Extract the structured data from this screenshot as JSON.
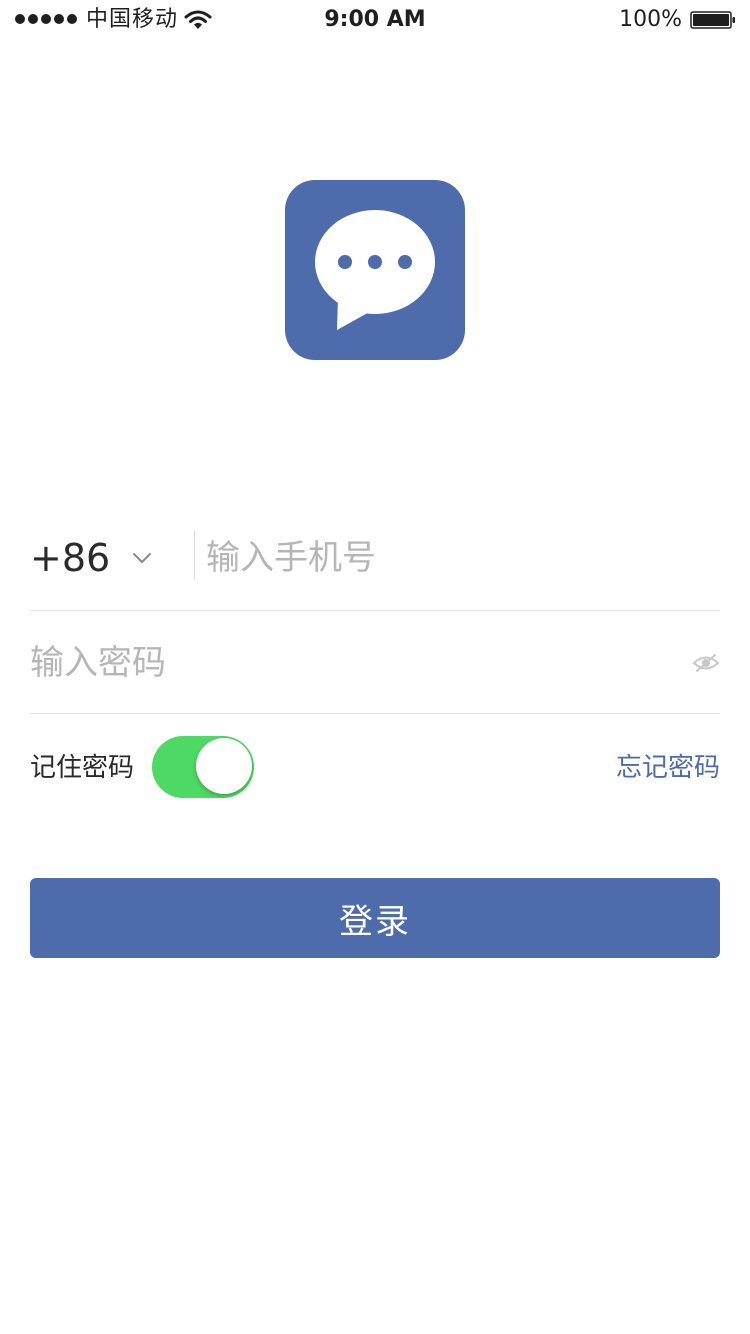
{
  "status_bar": {
    "carrier": "中国移动",
    "time": "9:00 AM",
    "battery": "100%",
    "icons": [
      "signal-dots",
      "wifi-icon",
      "battery-icon"
    ]
  },
  "logo": {
    "icon": "chat-bubble-icon",
    "background_color": "#4e6bab"
  },
  "phone": {
    "country_code": "+86",
    "placeholder": "输入手机号",
    "value": ""
  },
  "password": {
    "placeholder": "输入密码",
    "value": "",
    "visibility_icon": "eye-off-icon"
  },
  "remember": {
    "label": "记住密码",
    "enabled": true,
    "toggle_color": "#4cd964"
  },
  "forgot_password": {
    "label": "忘记密码",
    "color": "#4e6bab"
  },
  "login_button": {
    "label": "登录",
    "color": "#4e6bab"
  }
}
